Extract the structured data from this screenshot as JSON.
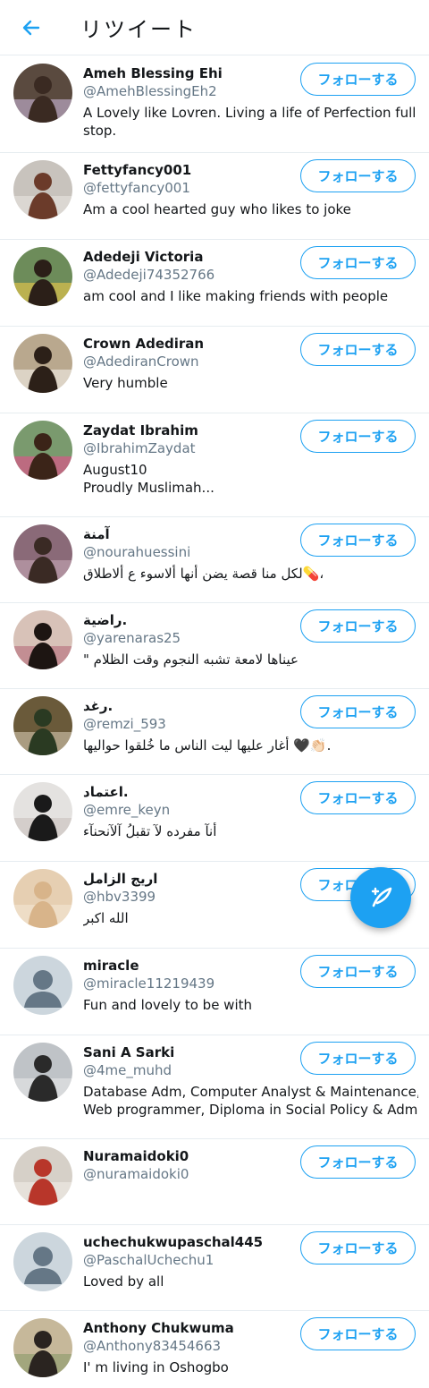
{
  "header": {
    "title": "リツイート",
    "back_icon": "arrow-left-icon"
  },
  "follow_label": "フォローする",
  "fab": {
    "icon": "compose-feather-icon"
  },
  "colors": {
    "accent": "#1da1f2",
    "secondary_text": "#657786",
    "divider": "#e6ecf0"
  },
  "users": [
    {
      "name": "Ameh Blessing Ehi",
      "handle": "@AmehBlessingEh2",
      "bio": [
        "A Lovely like Lovren. Living a life of Perfection full",
        "stop."
      ]
    },
    {
      "name": "Fettyfancy001",
      "handle": "@fettyfancy001",
      "bio": [
        "Am a cool hearted guy who likes to joke"
      ]
    },
    {
      "name": "Adedeji Victoria",
      "handle": "@Adedeji74352766",
      "bio": [
        "am cool and I like making friends with people"
      ]
    },
    {
      "name": "Crown Adediran",
      "handle": "@AdediranCrown",
      "bio": [
        "Very humble"
      ]
    },
    {
      "name": "Zaydat Ibrahim",
      "handle": "@IbrahimZaydat",
      "bio": [
        "August10",
        "Proudly Muslimah..."
      ]
    },
    {
      "name": "آمنة",
      "handle": "@nourahuessini",
      "bio": [
        "لكل منا قصة يضن أنها ألاسوء عِ ألاطلاق💊،"
      ]
    },
    {
      "name": "راضية.",
      "handle": "@yarenaras25",
      "bio": [
        "\" عيناها لامعة تشبه النجوم وقت الظلام"
      ]
    },
    {
      "name": "رغد.",
      "handle": "@remzi_593",
      "bio": [
        "أغار عليها ليت الناس ما خُلقوا حواليها 🖤👏🏻."
      ]
    },
    {
      "name": "اعتماد.",
      "handle": "@emre_keyn",
      "bio": [
        "أنآ مفرده لآ تقبلُ آلآنحنآء"
      ]
    },
    {
      "name": "اريج الزامل",
      "handle": "@hbv3399",
      "bio": [
        "الله اكبر"
      ]
    },
    {
      "name": "miracle",
      "handle": "@miracle11219439",
      "bio": [
        "Fun and lovely to be with"
      ]
    },
    {
      "name": "Sani A Sarki",
      "handle": "@4me_muhd",
      "bio": [
        "Database Adm, Computer Analyst & Maintenance,",
        "Web programmer, Diploma in Social Policy & Adm (..."
      ]
    },
    {
      "name": "Nuramaidoki0",
      "handle": "@nuramaidoki0",
      "bio": []
    },
    {
      "name": "uchechukwupaschal445",
      "handle": "@PaschalUchechu1",
      "bio": [
        "Loved by all"
      ]
    },
    {
      "name": "Anthony Chukwuma",
      "handle": "@Anthony83454663",
      "bio": [
        "I' m living in Oshogbo"
      ]
    }
  ]
}
